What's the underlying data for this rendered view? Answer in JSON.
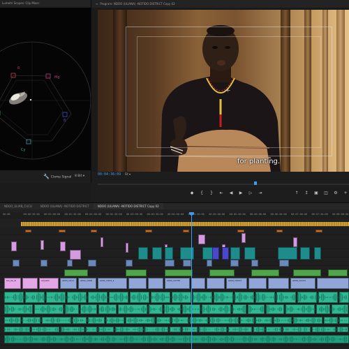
{
  "scope": {
    "title": "Lumetri Scopes: Clip Mixer",
    "clamp_signal": "Clamp Signal",
    "bit_depth": "8 Bit",
    "vectorscope_labels": [
      "R",
      "Mg",
      "B",
      "Cy",
      "G",
      "YL"
    ]
  },
  "program": {
    "title": "Program: NDOO (ULIANA) -NOTIDO DISTRICT Copy 02",
    "timecode": "00:04:36:09",
    "fit": "Fit",
    "caption": "for planting."
  },
  "timeline": {
    "tabs": [
      "NDOO_ULIAN_CUCU",
      "NDOO (ULIANA) -NOTIDO DISTRICT",
      "NDOO (ULIANA) -NOTIDO DISTRICT Copy 02"
    ],
    "active_tab": 2,
    "ruler": [
      "00:00",
      "00:00:30:00",
      "00:01:00:00",
      "00:01:30:00",
      "00:02:00:00",
      "00:02:30:00",
      "00:03:00:00",
      "00:03:30:00",
      "00:04:00:00",
      "00:04:30:00",
      "00:05:00:00",
      "00:05:30:00",
      "00:06:00:00",
      "00:06:30:00",
      "00:07:00:00",
      "00:07:30:00",
      "00:08:00:00"
    ],
    "clip_labels": [
      "GG_0A_B",
      "Adjustm",
      "A003_C011",
      "A002_C008",
      "A001_C004_1",
      "A003_C0156",
      "A004_C0023",
      "A006_C0131"
    ]
  },
  "colors": {
    "accent": "#3d9bf0",
    "video_clip": "#8fa6d6",
    "audio_clip": "#2fb892",
    "adjustment_clip": "#d59be0",
    "teal_clip": "#1f8c8c",
    "caption_clip": "#4fa64a",
    "render_bar": "#d6a43a"
  }
}
